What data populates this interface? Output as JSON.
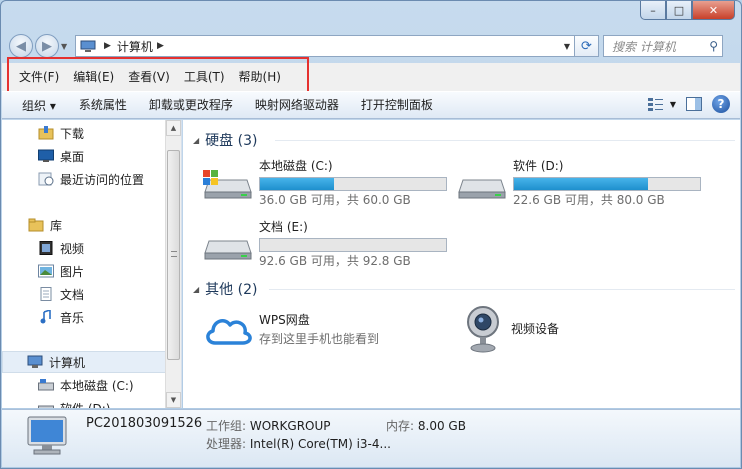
{
  "window": {
    "caption": {
      "min": "–",
      "max": "□",
      "close": "✕"
    }
  },
  "address": {
    "path": "计算机",
    "search_placeholder": "搜索 计算机"
  },
  "menu": {
    "items": [
      "文件(F)",
      "编辑(E)",
      "查看(V)",
      "工具(T)",
      "帮助(H)"
    ]
  },
  "toolbar": {
    "organize": "组织 ▾",
    "items": [
      "系统属性",
      "卸载或更改程序",
      "映射网络驱动器",
      "打开控制面板"
    ]
  },
  "nav": {
    "favorites": [
      {
        "label": "下载",
        "icon": "downloads-folder-icon"
      },
      {
        "label": "桌面",
        "icon": "desktop-icon"
      },
      {
        "label": "最近访问的位置",
        "icon": "recent-places-icon"
      }
    ],
    "library": {
      "label": "库",
      "icon": "library-icon"
    },
    "libraries": [
      {
        "label": "视频",
        "icon": "video-icon"
      },
      {
        "label": "图片",
        "icon": "picture-icon"
      },
      {
        "label": "文档",
        "icon": "document-icon"
      },
      {
        "label": "音乐",
        "icon": "music-icon"
      }
    ],
    "computer": {
      "label": "计算机",
      "icon": "computer-icon"
    },
    "drives": [
      {
        "label": "本地磁盘 (C:)",
        "icon": "drive-icon"
      },
      {
        "label": "软件 (D:)",
        "icon": "drive-icon"
      }
    ]
  },
  "groups": {
    "hdd": {
      "title": "硬盘 (3)"
    },
    "other": {
      "title": "其他 (2)"
    }
  },
  "drives": [
    {
      "name": "本地磁盘 (C:)",
      "free": "36.0 GB 可用，共 60.0 GB",
      "used_fraction": 0.4
    },
    {
      "name": "软件 (D:)",
      "free": "22.6 GB 可用，共 80.0 GB",
      "used_fraction": 0.72
    },
    {
      "name": "文档 (E:)",
      "free": "92.6 GB 可用，共 92.8 GB",
      "used_fraction": 0.002
    }
  ],
  "other": [
    {
      "name": "WPS网盘",
      "sub": "存到这里手机也能看到",
      "icon": "cloud-icon"
    },
    {
      "name": "视频设备",
      "sub": "",
      "icon": "webcam-icon"
    }
  ],
  "details": {
    "pc_name": "PC201803091526",
    "workgroup_label": "工作组:",
    "workgroup": "WORKGROUP",
    "memory_label": "内存:",
    "memory": "8.00 GB",
    "cpu_label": "处理器:",
    "cpu": "Intel(R) Core(TM) i3-4..."
  },
  "colors": {
    "accent": "#1e8fcd",
    "highlight_box": "#e5312f",
    "heading": "#1e395b"
  }
}
